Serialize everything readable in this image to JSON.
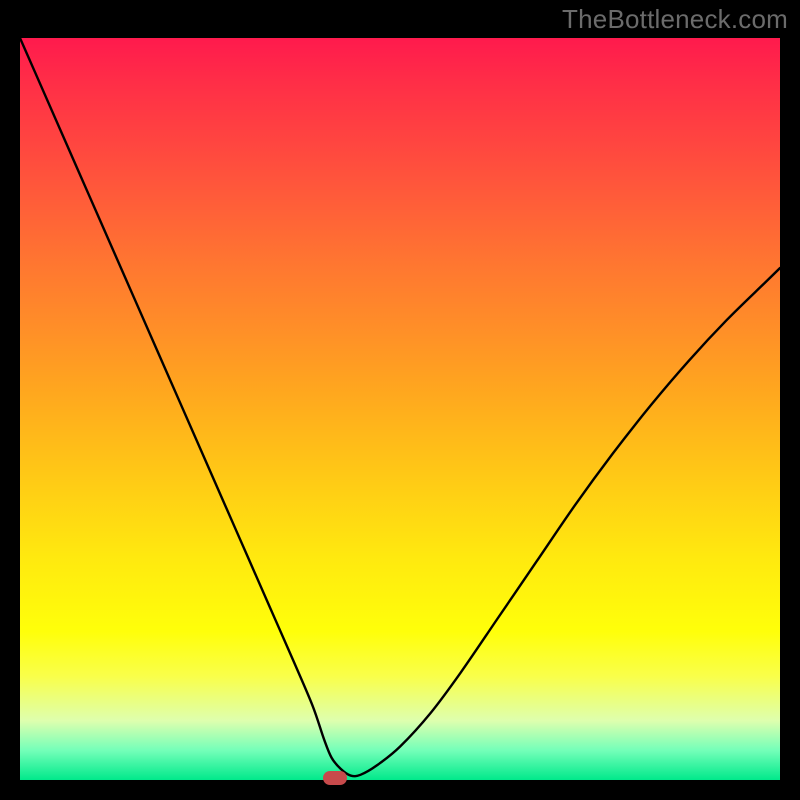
{
  "watermark": "TheBottleneck.com",
  "chart_data": {
    "type": "line",
    "title": "",
    "xlabel": "",
    "ylabel": "",
    "xlim": [
      0,
      100
    ],
    "ylim": [
      0,
      100
    ],
    "grid": false,
    "series": [
      {
        "name": "curve",
        "x": [
          0,
          3,
          6,
          9,
          12,
          15,
          18,
          21,
          24,
          27,
          30,
          33,
          36,
          38.5,
          40,
          41,
          42.2,
          43.5,
          44.8,
          47,
          50,
          54,
          58,
          63,
          68,
          73,
          78,
          83,
          88,
          93,
          98,
          100
        ],
        "values": [
          100,
          93,
          86,
          79,
          72,
          65,
          58,
          51,
          44,
          37,
          30,
          23,
          16,
          10,
          5.5,
          3,
          1.5,
          0.6,
          0.7,
          2,
          4.5,
          9,
          14.5,
          22,
          29.5,
          37,
          44,
          50.5,
          56.5,
          62,
          67,
          69
        ]
      }
    ],
    "marker": {
      "x": 41.5,
      "y": 0.3,
      "color": "#c74a4b"
    },
    "gradient_stops": [
      {
        "pos": 0,
        "color": "#ff1a4d"
      },
      {
        "pos": 50,
        "color": "#ffb81c"
      },
      {
        "pos": 80,
        "color": "#ffff0a"
      },
      {
        "pos": 100,
        "color": "#00e98b"
      }
    ]
  }
}
